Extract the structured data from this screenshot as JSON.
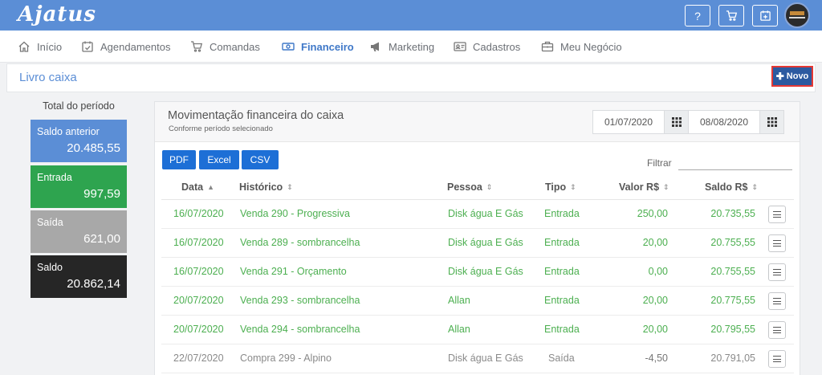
{
  "app": {
    "logo": "Ajatus"
  },
  "topbar": {
    "help_label": "?"
  },
  "nav": {
    "items": [
      {
        "label": "Início",
        "icon": "home-icon"
      },
      {
        "label": "Agendamentos",
        "icon": "calendar-check-icon"
      },
      {
        "label": "Comandas",
        "icon": "cart-icon"
      },
      {
        "label": "Financeiro",
        "icon": "money-icon",
        "active": true
      },
      {
        "label": "Marketing",
        "icon": "megaphone-icon"
      },
      {
        "label": "Cadastros",
        "icon": "id-card-icon"
      },
      {
        "label": "Meu Negócio",
        "icon": "briefcase-icon"
      }
    ]
  },
  "page": {
    "title": "Livro caixa",
    "new_button": "Novo"
  },
  "summary": {
    "title": "Total do período",
    "cards": [
      {
        "label": "Saldo anterior",
        "value": "20.485,55",
        "color": "#5b8ed6"
      },
      {
        "label": "Entrada",
        "value": "997,59",
        "color": "#2ea44f"
      },
      {
        "label": "Saída",
        "value": "621,00",
        "color": "#a8a8a8"
      },
      {
        "label": "Saldo",
        "value": "20.862,14",
        "color": "#262626"
      }
    ]
  },
  "panel": {
    "title": "Movimentação financeira do caixa",
    "subtitle": "Conforme período selecionado",
    "date_from": "01/07/2020",
    "date_to": "08/08/2020",
    "export": [
      "PDF",
      "Excel",
      "CSV"
    ],
    "filter_label": "Filtrar"
  },
  "table": {
    "columns": [
      "Data",
      "Histórico",
      "Pessoa",
      "Tipo",
      "Valor R$",
      "Saldo R$"
    ],
    "rows": [
      {
        "data": "16/07/2020",
        "historico": "Venda 290 - Progressiva",
        "pessoa": "Disk água E Gás",
        "tipo": "Entrada",
        "valor": "250,00",
        "saldo": "20.735,55"
      },
      {
        "data": "16/07/2020",
        "historico": "Venda 289 - sombrancelha",
        "pessoa": "Disk água E Gás",
        "tipo": "Entrada",
        "valor": "20,00",
        "saldo": "20.755,55"
      },
      {
        "data": "16/07/2020",
        "historico": "Venda 291 - Orçamento",
        "pessoa": "Disk água E Gás",
        "tipo": "Entrada",
        "valor": "0,00",
        "saldo": "20.755,55"
      },
      {
        "data": "20/07/2020",
        "historico": "Venda 293 - sombrancelha",
        "pessoa": "Allan",
        "tipo": "Entrada",
        "valor": "20,00",
        "saldo": "20.775,55"
      },
      {
        "data": "20/07/2020",
        "historico": "Venda 294 - sombrancelha",
        "pessoa": "Allan",
        "tipo": "Entrada",
        "valor": "20,00",
        "saldo": "20.795,55"
      },
      {
        "data": "22/07/2020",
        "historico": "Compra 299 - Alpino",
        "pessoa": "Disk água E Gás",
        "tipo": "Saída",
        "valor": "-4,50",
        "saldo": "20.791,05"
      }
    ]
  }
}
